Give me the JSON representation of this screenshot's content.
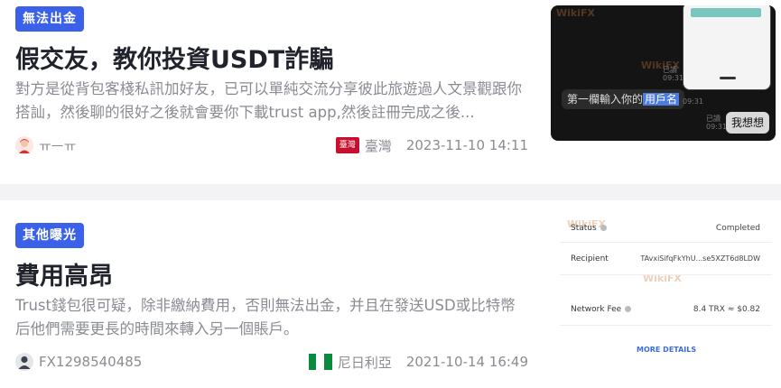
{
  "articles": [
    {
      "tag": "無法出金",
      "title": "假交友，教你投資USDT詐騙",
      "description": "對方是從背包客棧私訊加好友，已可以單純交流分享彼此旅遊過人文景觀跟你搭訕，然後聊的很好之後就會要你下載trust app,然後註冊完成之後...",
      "author": "ㅠㅡㅠ",
      "region": "臺灣",
      "flag_text": "臺灣",
      "date": "2023-11-10 14:11",
      "thumbnail": {
        "bubble_prefix": "第一欄輸入你的",
        "bubble_highlight": "用戶名",
        "reply": "我想想",
        "time_a": "已讀",
        "time_b": "09:31",
        "watermark": "WikiFX"
      },
      "colors": {
        "tag": "#3b61e8",
        "flag": "#c8102e"
      }
    },
    {
      "tag": "其他曝光",
      "title": "費用高昂",
      "description": "Trust錢包很可疑，除非繳納費用，否則無法出金，并且在發送USD或比特幣后他們需要更長的時間來轉入另一個賬戶。",
      "author": "FX1298540485",
      "region": "尼日利亞",
      "date": "2021-10-14 16:49",
      "thumbnail": {
        "status_label": "Status",
        "status_value": "Completed",
        "recipient_label": "Recipient",
        "recipient_value": "TAvxiSifqFkYhU...se5XZT6d8LDW",
        "fee_label": "Network Fee",
        "fee_value": "8.4 TRX ≈ $0.82",
        "more": "MORE DETAILS",
        "watermark": "WikiFX"
      },
      "colors": {
        "tag": "#3b61e8",
        "flag_green": "#0a8a3c"
      }
    }
  ]
}
